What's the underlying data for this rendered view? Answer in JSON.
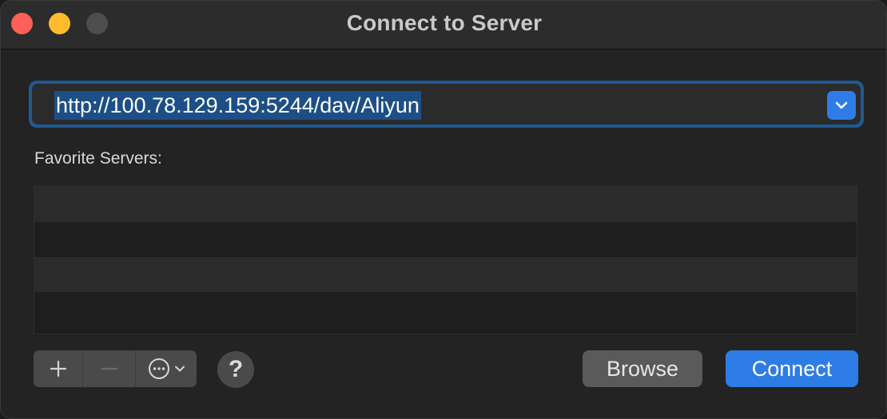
{
  "window": {
    "title": "Connect to Server"
  },
  "address": {
    "value": "http://100.78.129.159:5244/dav/Aliyun",
    "dropdown_icon": "chevron-down-icon"
  },
  "favorites": {
    "label": "Favorite Servers:",
    "items": []
  },
  "toolbar": {
    "add_icon": "plus-icon",
    "remove_icon": "minus-icon",
    "more_icon": "ellipsis-circle-icon",
    "help_label": "?"
  },
  "buttons": {
    "browse_label": "Browse",
    "connect_label": "Connect"
  },
  "colors": {
    "accent": "#2e7ce6",
    "close": "#fe5f57",
    "minimize": "#febc2e",
    "zoom_disabled": "#4d4d4d"
  }
}
